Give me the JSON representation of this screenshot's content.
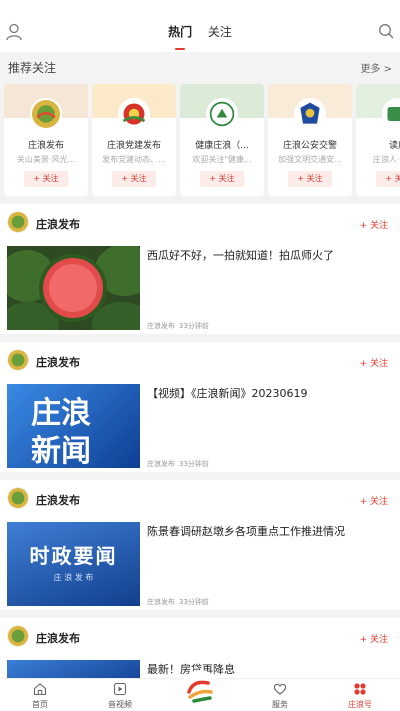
{
  "header": {
    "tabs": [
      {
        "label": "热门",
        "active": true
      },
      {
        "label": "关注",
        "active": false
      }
    ],
    "icons": {
      "left": "user-icon",
      "right": "search-icon"
    }
  },
  "recommend": {
    "title": "推荐关注",
    "more": "更多 >",
    "follow_label": "+ 关注",
    "cards": [
      {
        "name": "庄浪发布",
        "desc": "关山美景·风光..."
      },
      {
        "name": "庄浪党建发布",
        "desc": "发布党建动态、..."
      },
      {
        "name": "健康庄浪（...",
        "desc": "欢迎关注\"健康..."
      },
      {
        "name": "庄浪公安交警",
        "desc": "加强文明交通安..."
      },
      {
        "name": "读庄",
        "desc": "庄浪人·庄浪..."
      }
    ]
  },
  "feed": {
    "follow_label": "+ 关注",
    "posts": [
      {
        "author": "庄浪发布",
        "title": "西瓜好不好，一拍就知道！拍瓜师火了",
        "source": "庄浪发布",
        "time": "33分钟前",
        "thumb": "watermelon"
      },
      {
        "author": "庄浪发布",
        "title": "【视频】《庄浪新闻》20230619",
        "source": "庄浪发布",
        "time": "33分钟前",
        "thumb": "news",
        "thumb_text": [
          "庄浪",
          "新闻"
        ]
      },
      {
        "author": "庄浪发布",
        "title": "陈景春调研赵墩乡各项重点工作推进情况",
        "source": "庄浪发布",
        "time": "33分钟前",
        "thumb": "politics",
        "thumb_text": [
          "时政要闻",
          "庄 浪 发 布"
        ]
      },
      {
        "author": "庄浪发布",
        "title": "最新！房贷再降息",
        "source": "",
        "time": "",
        "thumb": "blue"
      }
    ]
  },
  "bottom_nav": [
    {
      "label": "首页",
      "icon": "home-icon",
      "active": false
    },
    {
      "label": "音视频",
      "icon": "video-icon",
      "active": false
    },
    {
      "label": "",
      "icon": "logo-icon",
      "active": false
    },
    {
      "label": "服务",
      "icon": "heart-icon",
      "active": false
    },
    {
      "label": "庄浪号",
      "icon": "grid-icon",
      "active": true
    }
  ],
  "colors": {
    "accent": "#e23a2d",
    "background": "#f3f3f3"
  }
}
